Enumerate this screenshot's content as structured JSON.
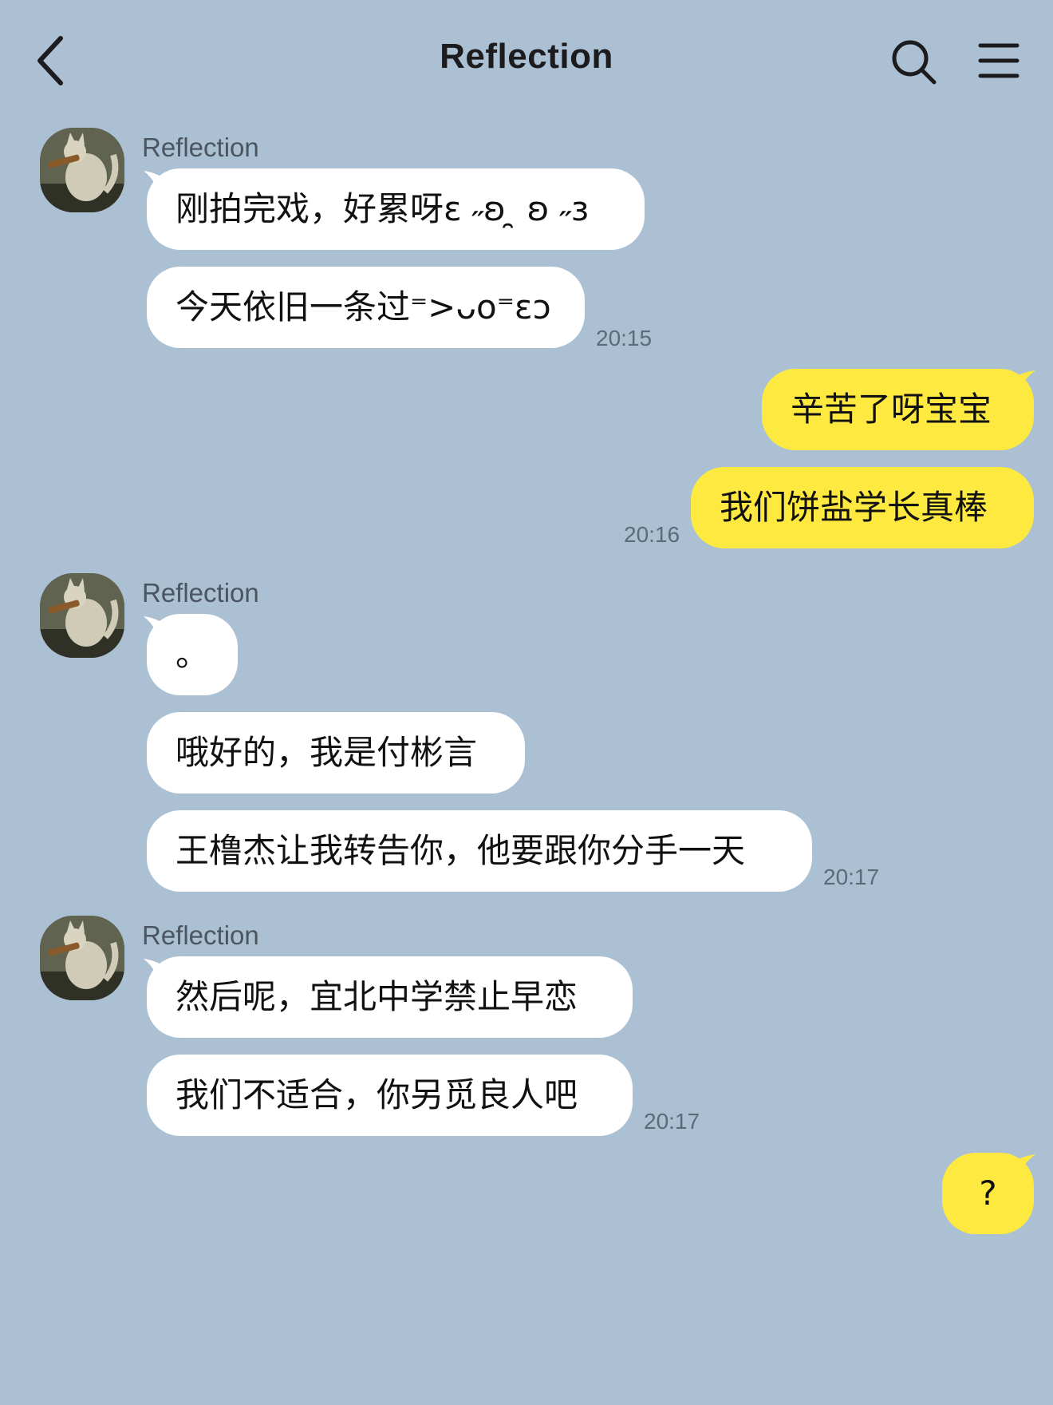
{
  "header": {
    "title": "Reflection",
    "back_icon": "chevron-left-icon",
    "search_icon": "search-icon",
    "menu_icon": "hamburger-menu-icon"
  },
  "colors": {
    "background": "#abc1d3",
    "incoming_bubble": "#ffffff",
    "outgoing_bubble": "#fee940"
  },
  "messages": {
    "g1": {
      "sender": "Reflection",
      "m1": "刚拍完戏，好累呀ε ˶ʚ ̯ ʚ ˶ɜ",
      "m2": "今天依旧一条过⁼>ᴗo⁼εᴐ",
      "time": "20:15"
    },
    "out1": {
      "m1": "辛苦了呀宝宝",
      "m2": "我们饼盐学长真棒",
      "time": "20:16"
    },
    "g2": {
      "sender": "Reflection",
      "m1": "。",
      "m2": "哦好的，我是付彬言",
      "m3": "王橹杰让我转告你，他要跟你分手一天",
      "time": "20:17"
    },
    "g3": {
      "sender": "Reflection",
      "m1": "然后呢，宜北中学禁止早恋",
      "m2": "我们不适合，你另觅良人吧",
      "time": "20:17"
    },
    "out2": {
      "m1": "?"
    }
  }
}
